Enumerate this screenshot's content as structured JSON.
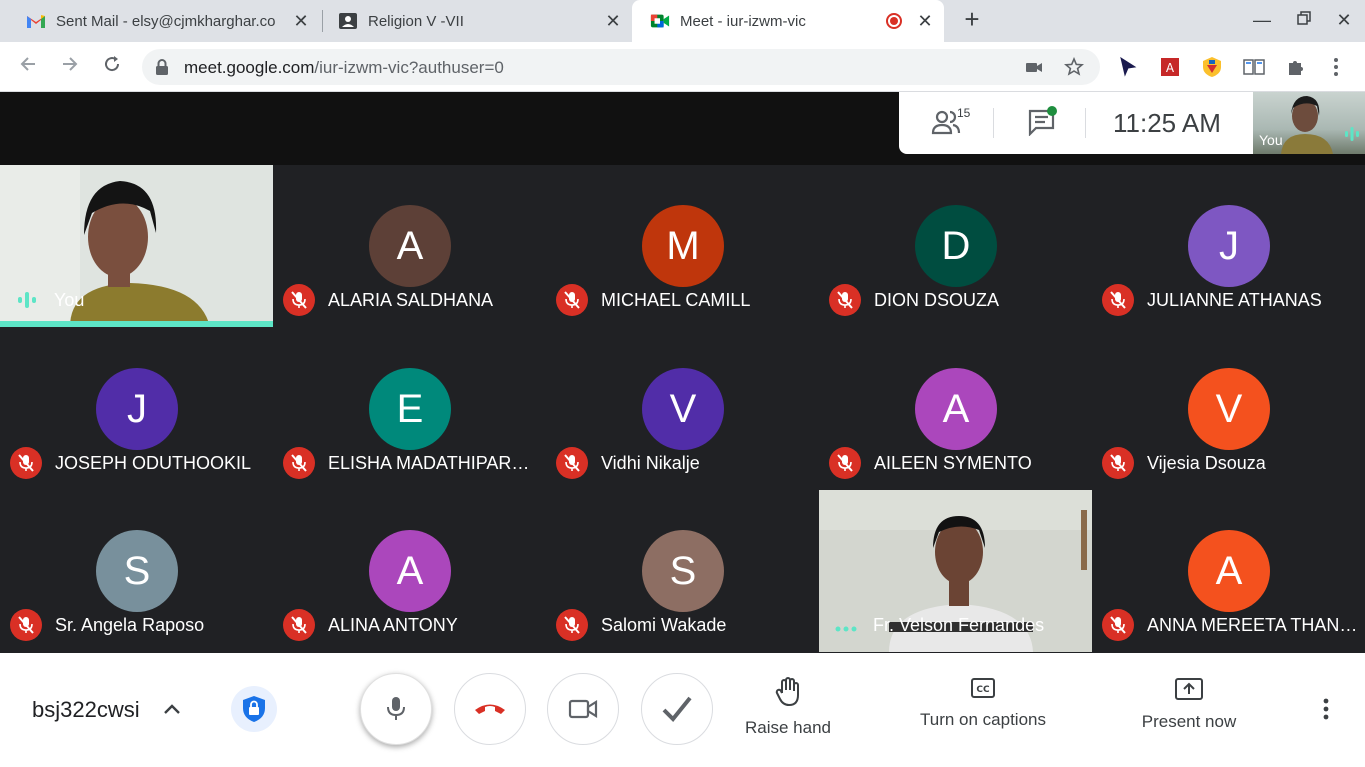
{
  "browser": {
    "tabs": [
      {
        "title": "Sent Mail - elsy@cjmkharghar.co",
        "icon": "gmail-icon"
      },
      {
        "title": "Religion V -VII",
        "icon": "classroom-icon"
      },
      {
        "title": "Meet - iur-izwm-vic",
        "icon": "meet-icon",
        "active": true
      }
    ],
    "url_host": "meet.google.com",
    "url_path": "/iur-izwm-vic?authuser=0"
  },
  "meeting": {
    "participant_count": "15",
    "time": "11:25  AM",
    "self_label": "You",
    "code": "bsj322cwsi"
  },
  "participants": [
    {
      "name": "You",
      "video": true,
      "speaking": true
    },
    {
      "name": "ALARIA SALDHANA",
      "initial": "A",
      "color": "#5d4037",
      "muted": true
    },
    {
      "name": "MICHAEL CAMILL",
      "initial": "M",
      "color": "#bf360c",
      "muted": true
    },
    {
      "name": "DION DSOUZA",
      "initial": "D",
      "color": "#004d40",
      "muted": true
    },
    {
      "name": "JULIANNE ATHANAS",
      "initial": "J",
      "color": "#7e57c2",
      "muted": true
    },
    {
      "name": "JOSEPH ODUTHOOKIL",
      "initial": "J",
      "color": "#512da8",
      "muted": true
    },
    {
      "name": "ELISHA MADATHIPARAMBIL",
      "initial": "E",
      "color": "#00897b",
      "muted": true
    },
    {
      "name": "Vidhi Nikalje",
      "initial": "V",
      "color": "#512da8",
      "muted": true
    },
    {
      "name": "AILEEN SYMENTO",
      "initial": "A",
      "color": "#ab47bc",
      "muted": true
    },
    {
      "name": "Vijesia Dsouza",
      "initial": "V",
      "color": "#f4511e",
      "muted": true
    },
    {
      "name": "Sr. Angela Raposo",
      "initial": "S",
      "color": "#78909c",
      "muted": true
    },
    {
      "name": "ALINA ANTONY",
      "initial": "A",
      "color": "#ab47bc",
      "muted": true
    },
    {
      "name": "Salomi Wakade",
      "initial": "S",
      "color": "#8d6e63",
      "muted": true
    },
    {
      "name": "Fr. Velson Fernandes",
      "video": true,
      "speaking": false
    },
    {
      "name": "ANNA MEREETA THANIKKAL",
      "initial": "A",
      "color": "#f4511e",
      "muted": true
    }
  ],
  "controls": {
    "raise_hand": "Raise hand",
    "captions": "Turn on captions",
    "present": "Present now"
  },
  "colors": {
    "mute_red": "#d93025",
    "speaking_teal": "#5de5c6",
    "grid_bg": "#202124"
  }
}
